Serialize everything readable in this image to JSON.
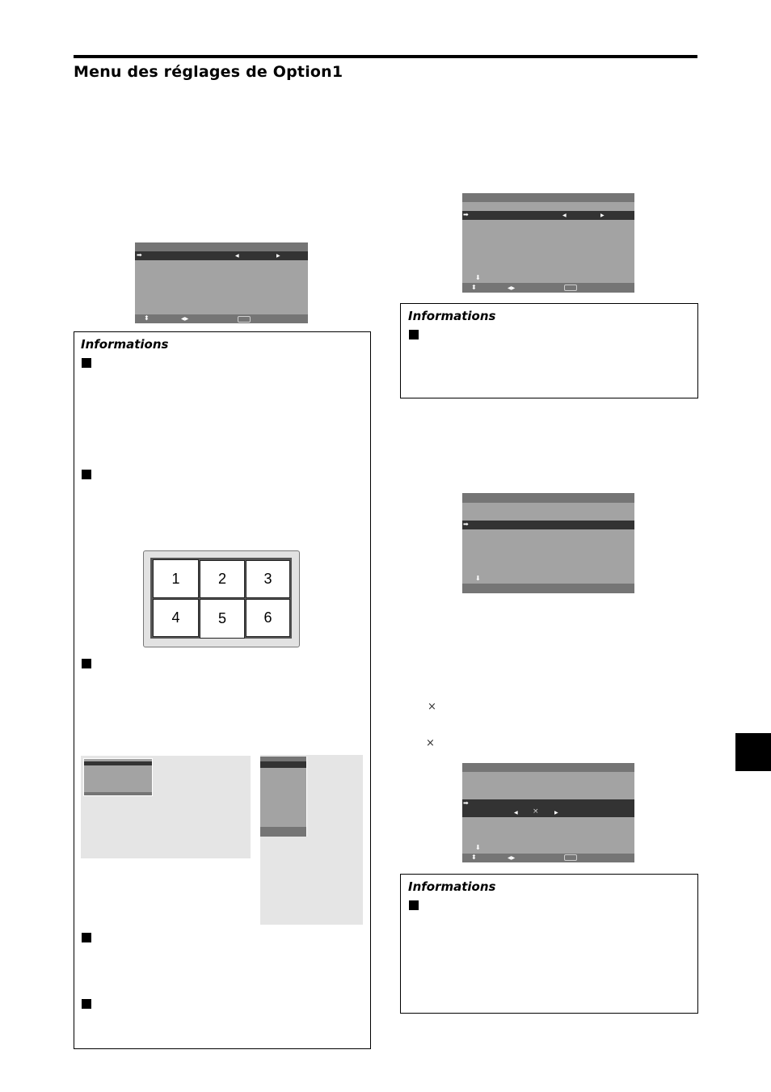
{
  "page": {
    "title": "Menu des réglages de Option1"
  },
  "info_boxes": [
    {
      "title": "Informations"
    },
    {
      "title": "Informations"
    },
    {
      "title": "Informations"
    }
  ],
  "grid_diagram": {
    "cells": [
      "1",
      "2",
      "3",
      "4",
      "5",
      "6"
    ]
  },
  "osd_menus": {
    "icons": {
      "select_arrow": "➡",
      "left_arrow": "◀",
      "right_arrow": "▶",
      "up_down": "⬍",
      "left_right": "◀▶",
      "down_arrow": "⬇",
      "close_x": "×"
    }
  },
  "marks": {
    "multiply_sign": "×"
  }
}
